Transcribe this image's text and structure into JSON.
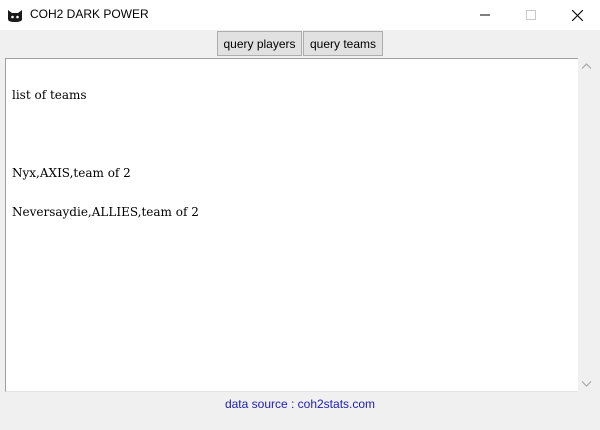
{
  "window": {
    "title": "COH2 DARK POWER",
    "app_icon": "cat-icon",
    "controls": [
      "minimize-icon",
      "maximize-icon",
      "close-icon"
    ]
  },
  "toolbar": {
    "query_players_label": "query players",
    "query_teams_label": "query teams"
  },
  "output": {
    "lines": [
      "list of teams",
      "",
      "Nyx,AXIS,team of 2",
      "Neversaydie,ALLIES,team of 2"
    ]
  },
  "footer": {
    "source_text": "data source : coh2stats.com"
  },
  "colors": {
    "footer_link": "#1c1cb0",
    "window_bg": "#f0f0f0"
  }
}
